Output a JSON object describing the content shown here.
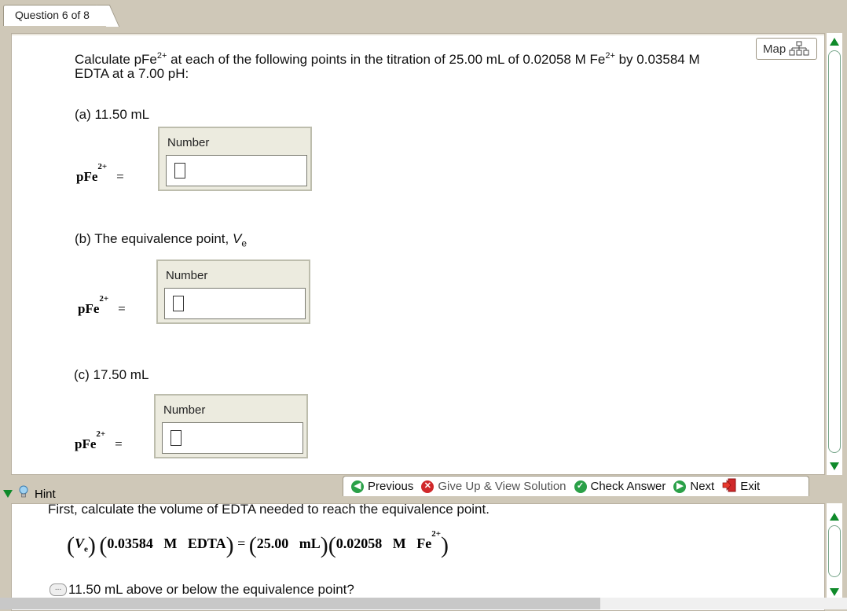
{
  "tab": {
    "label": "Question 6 of 8"
  },
  "map": {
    "label": "Map"
  },
  "question": {
    "line1_pre": "Calculate pFe",
    "ion_charge": "2+",
    "line1_mid": " at each of the following points in the titration of 25.00 mL of 0.02058 M Fe",
    "line1_post": " by 0.03584 M",
    "line2": "EDTA at a 7.00 pH:"
  },
  "parts": [
    {
      "label": "(a) 11.50 mL",
      "box_label": "Number",
      "lhs": "pFe",
      "charge": "2+",
      "eq": "=",
      "value": ""
    },
    {
      "label_pre": "(b) The equivalence point, ",
      "label_var": "V",
      "label_sub": "e",
      "box_label": "Number",
      "lhs": "pFe",
      "charge": "2+",
      "eq": "=",
      "value": ""
    },
    {
      "label": "(c) 17.50 mL",
      "box_label": "Number",
      "lhs": "pFe",
      "charge": "2+",
      "eq": "=",
      "value": ""
    }
  ],
  "nav": {
    "previous": "Previous",
    "give_up": "Give Up & View Solution",
    "check": "Check Answer",
    "next": "Next",
    "exit": "Exit"
  },
  "hint": {
    "label": "Hint",
    "text1": "First, calculate the volume of EDTA needed to reach the equivalence point.",
    "eq": {
      "v": "V",
      "v_sub": "e",
      "term1": "0.03584   M   EDTA",
      "equals": "=",
      "term2": "25.00   mL",
      "term3": "0.02058   M   Fe",
      "charge": "2+"
    },
    "text2": "11.50 mL above or below the equivalence point?",
    "more_icon": "..."
  },
  "colors": {
    "green": "#0f8a2a",
    "red": "#d0282a",
    "nav_green": "#2aa048"
  }
}
